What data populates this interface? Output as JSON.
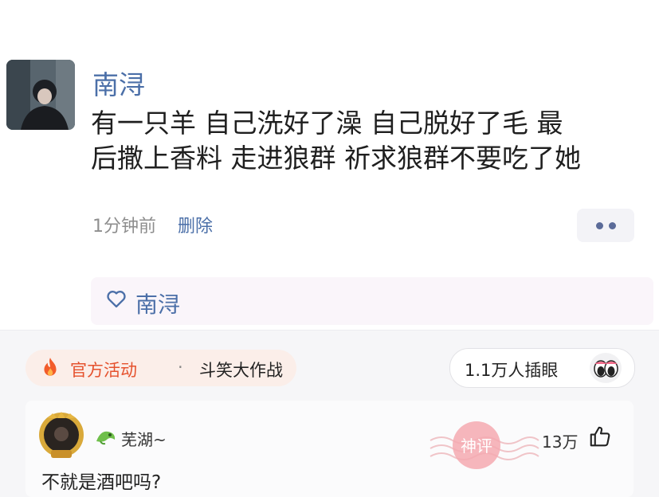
{
  "post": {
    "author": "南浔",
    "content_line1": "有一只羊 自己洗好了澡 自己脱好了毛 最",
    "content_line2": "后撒上香料 走进狼群 祈求狼群不要吃了她",
    "time": "1分钟前",
    "delete_label": "删除",
    "liker_name": "南浔"
  },
  "event": {
    "label": "官方活动",
    "separator": "·",
    "name": "斗笑大作战"
  },
  "views": {
    "text": "1.1万人插眼"
  },
  "comment": {
    "user": "芜湖~",
    "likes": "13万",
    "text": "不就是酒吧吗?",
    "stamp_text": "神评"
  },
  "colors": {
    "link": "#4b6fa8",
    "accent": "#e5512d",
    "stamp": "#f0a0a8"
  },
  "icons": [
    "avatar",
    "heart-icon",
    "fire-icon",
    "eyes-icon",
    "badge-avatar",
    "dragon-icon",
    "stamp",
    "thumb-up-icon",
    "more-icon"
  ]
}
